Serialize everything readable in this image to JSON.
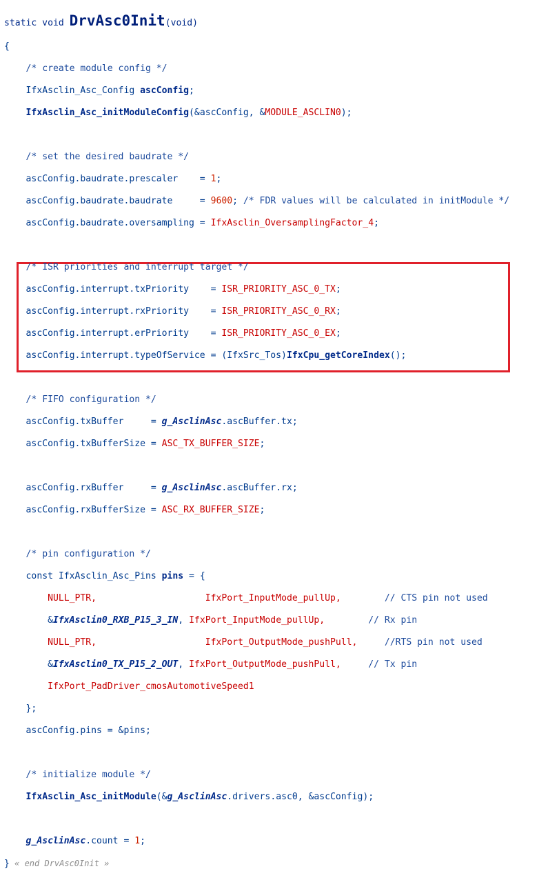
{
  "l1": {
    "a": "static void ",
    "b": "DrvAsc0Init",
    "c": "(void)"
  },
  "l2": "{",
  "l3": "/* create module config */",
  "l4": {
    "a": "IfxAsclin_Asc_Config ",
    "b": "ascConfig",
    "c": ";"
  },
  "l5": {
    "a": "IfxAsclin_Asc_initModuleConfig",
    "b": "(&ascConfig, &",
    "c": "MODULE_ASCLIN0",
    "d": ");"
  },
  "l7": "/* set the desired baudrate */",
  "l8": {
    "a": "ascConfig.baudrate.prescaler    = ",
    "b": "1",
    "c": ";"
  },
  "l9": {
    "a": "ascConfig.baudrate.baudrate     = ",
    "b": "9600",
    "c": "; ",
    "d": "/* FDR values will be calculated in initModule */"
  },
  "l10": {
    "a": "ascConfig.baudrate.oversampling = ",
    "b": "IfxAsclin_OversamplingFactor_4",
    "c": ";"
  },
  "l12": "/* ISR priorities and interrupt target */",
  "l13": {
    "a": "ascConfig.interrupt.txPriority    = ",
    "b": "ISR_PRIORITY_ASC_0_TX",
    "c": ";"
  },
  "l14": {
    "a": "ascConfig.interrupt.rxPriority    = ",
    "b": "ISR_PRIORITY_ASC_0_RX",
    "c": ";"
  },
  "l15": {
    "a": "ascConfig.interrupt.erPriority    = ",
    "b": "ISR_PRIORITY_ASC_0_EX",
    "c": ";"
  },
  "l16": {
    "a": "ascConfig.interrupt.typeOfService = (IfxSrc_Tos)",
    "b": "IfxCpu_getCoreIndex",
    "c": "();"
  },
  "l18": "/* FIFO configuration */",
  "l19": {
    "a": "ascConfig.txBuffer     = ",
    "b": "g_AsclinAsc",
    "c": ".ascBuffer.tx;"
  },
  "l20": {
    "a": "ascConfig.txBufferSize = ",
    "b": "ASC_TX_BUFFER_SIZE",
    "c": ";"
  },
  "l22": {
    "a": "ascConfig.rxBuffer     = ",
    "b": "g_AsclinAsc",
    "c": ".ascBuffer.rx;"
  },
  "l23": {
    "a": "ascConfig.rxBufferSize = ",
    "b": "ASC_RX_BUFFER_SIZE",
    "c": ";"
  },
  "l25": "/* pin configuration */",
  "l26": {
    "a": "const IfxAsclin_Asc_Pins ",
    "b": "pins",
    "c": " = {"
  },
  "l27": {
    "a": "NULL_PTR,",
    "b": "IfxPort_InputMode_pullUp,",
    "c": "// CTS pin not used"
  },
  "l28": {
    "a": "&",
    "b": "IfxAsclin0_RXB_P15_3_IN",
    "c": ", ",
    "d": "IfxPort_InputMode_pullUp,",
    "e": "// Rx pin"
  },
  "l29": {
    "a": "NULL_PTR,",
    "b": "IfxPort_OutputMode_pushPull,",
    "c": "//RTS pin not used"
  },
  "l30": {
    "a": "&",
    "b": "IfxAsclin0_TX_P15_2_OUT",
    "c": ", ",
    "d": "IfxPort_OutputMode_pushPull,",
    "e": "// Tx pin"
  },
  "l31": "IfxPort_PadDriver_cmosAutomotiveSpeed1",
  "l32": "};",
  "l33": {
    "a": "ascConfig.pins = &pins;"
  },
  "l35": "/* initialize module */",
  "l36": {
    "a": "IfxAsclin_Asc_initModule",
    "b": "(&",
    "c": "g_AsclinAsc",
    "d": ".drivers.asc0, &ascConfig);"
  },
  "l38": {
    "a": "g_AsclinAsc",
    "b": ".count = ",
    "c": "1",
    "d": ";"
  },
  "l39": {
    "a": "}",
    "b": " « end DrvAsc0Init »"
  },
  "colors": {
    "highlight_border": "#e0202a",
    "keyword": "#002a8a",
    "macro": "#c80000",
    "number": "#cc2200"
  }
}
